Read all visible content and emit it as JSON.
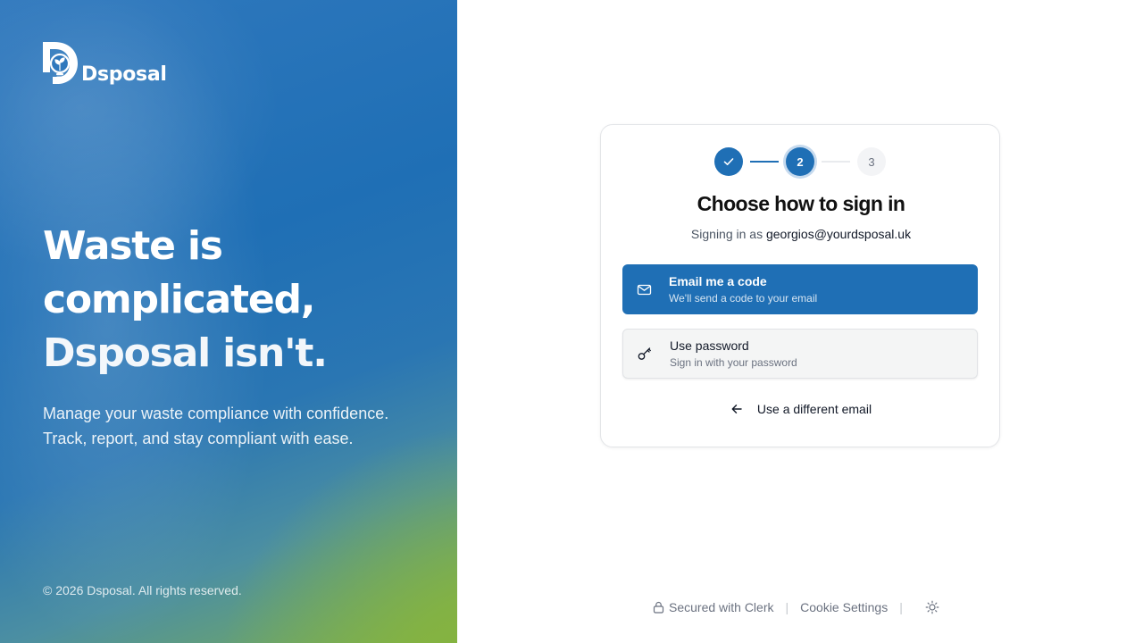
{
  "brand": {
    "name": "Dsposal"
  },
  "hero": {
    "headline_lines": [
      "Waste is",
      "complicated,",
      "Dsposal isn't."
    ],
    "subtitle_lines": [
      "Manage your waste compliance with confidence.",
      "Track, report, and stay compliant with ease."
    ],
    "copyright": "© 2026 Dsposal. All rights reserved."
  },
  "stepper": {
    "steps": [
      {
        "label": "",
        "state": "complete",
        "icon": "check-icon"
      },
      {
        "label": "2",
        "state": "current"
      },
      {
        "label": "3",
        "state": "upcoming"
      }
    ]
  },
  "card": {
    "title": "Choose how to sign in",
    "signing_prefix": "Signing in as",
    "email": "georgios@yourdsposal.uk",
    "options": [
      {
        "label": "Email me a code",
        "description": "We'll send a code to your email",
        "icon": "mail-icon",
        "selected": true
      },
      {
        "label": "Use password",
        "description": "Sign in with your password",
        "icon": "key-icon",
        "selected": false
      }
    ],
    "back_label": "Use a different email"
  },
  "footer": {
    "secured": "Secured with Clerk",
    "cookie": "Cookie Settings",
    "sep": "|"
  },
  "colors": {
    "primary": "#1f6fb5",
    "accent_green": "#86b43e"
  }
}
